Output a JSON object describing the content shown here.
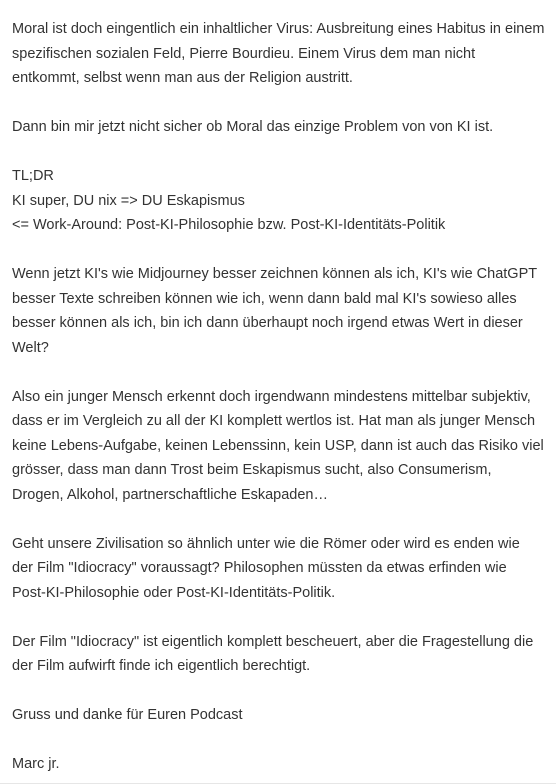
{
  "comment": {
    "paragraphs": [
      {
        "lines": [
          "Moral ist doch eingentlich ein inhaltlicher Virus: Ausbreitung eines Habitus in einem",
          "spezifischen sozialen Feld, Pierre Bourdieu. Einem Virus dem man nicht",
          "entkommt, selbst wenn man aus der Religion austritt."
        ]
      },
      {
        "lines": [
          "Dann bin mir jetzt nicht sicher ob Moral das einzige Problem von von KI ist."
        ]
      },
      {
        "lines": [
          "TL;DR",
          "KI super, DU nix => DU Eskapismus",
          "<= Work-Around: Post-KI-Philosophie bzw. Post-KI-Identitäts-Politik"
        ]
      },
      {
        "lines": [
          "Wenn jetzt KI's wie Midjourney besser zeichnen können als ich, KI's wie ChatGPT",
          "besser Texte schreiben können wie ich, wenn dann bald mal KI's sowieso alles",
          "besser können als ich, bin ich dann überhaupt noch irgend etwas Wert in dieser",
          "Welt?"
        ]
      },
      {
        "lines": [
          "Also ein junger Mensch erkennt doch irgendwann mindestens mittelbar subjektiv,",
          "dass er im Vergleich zu all der KI komplett wertlos ist. Hat man als junger Mensch",
          "keine Lebens-Aufgabe, keinen Lebenssinn, kein USP, dann ist auch das Risiko viel",
          "grösser, dass man dann Trost beim Eskapismus sucht, also Consumerism,",
          "Drogen, Alkohol, partnerschaftliche Eskapaden…"
        ]
      },
      {
        "lines": [
          "Geht unsere Zivilisation so ähnlich unter wie die Römer oder wird es enden wie",
          "der Film \"Idiocracy\" voraussagt? Philosophen müssten da etwas erfinden wie",
          "Post-KI-Philosophie oder Post-KI-Identitäts-Politik."
        ]
      },
      {
        "lines": [
          "Der Film \"Idiocracy\" ist eigentlich komplett bescheuert, aber die Fragestellung die",
          "der Film aufwirft finde ich eigentlich berechtigt."
        ]
      },
      {
        "lines": [
          "Gruss und danke für Euren Podcast"
        ]
      },
      {
        "lines": [
          "Marc jr."
        ]
      }
    ]
  }
}
